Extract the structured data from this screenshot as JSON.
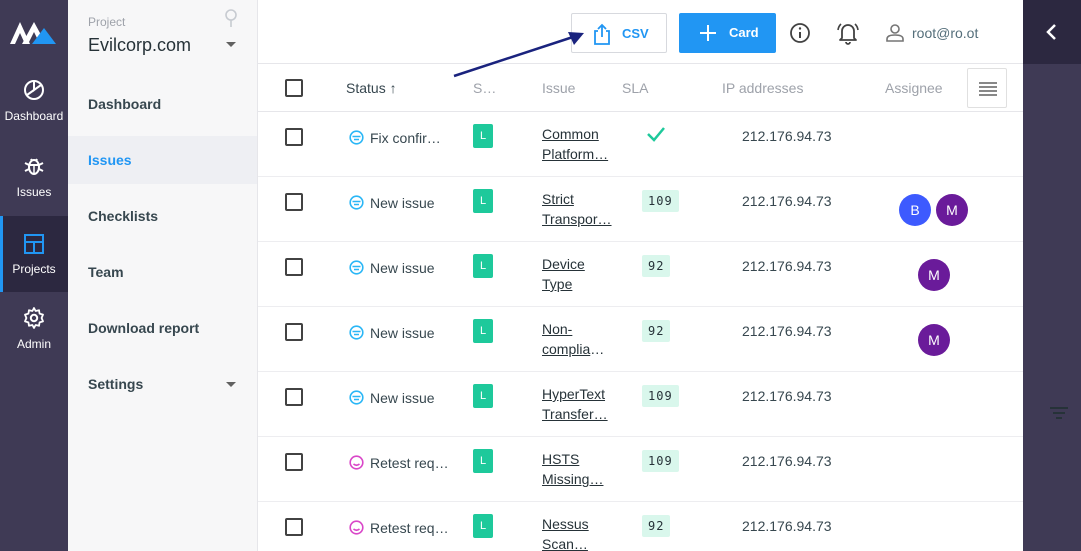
{
  "rail": {
    "items": [
      {
        "label": "Dashboard",
        "icon": "dashboard-icon"
      },
      {
        "label": "Issues",
        "icon": "bug-icon"
      },
      {
        "label": "Projects",
        "icon": "projects-icon"
      },
      {
        "label": "Admin",
        "icon": "gear-icon"
      }
    ],
    "active": "Projects",
    "colors": {
      "bg": "#3f3a55",
      "active_bg": "#2c2840",
      "accent": "#2196f3"
    }
  },
  "project": {
    "label": "Project",
    "name": "Evilcorp.com"
  },
  "sidebar": {
    "items": [
      {
        "label": "Dashboard"
      },
      {
        "label": "Issues"
      },
      {
        "label": "Checklists"
      },
      {
        "label": "Team"
      },
      {
        "label": "Download report"
      },
      {
        "label": "Settings"
      }
    ],
    "active": "Issues"
  },
  "toolbar": {
    "csv_label": "CSV",
    "card_label": "Card",
    "user": "root@ro.ot"
  },
  "table": {
    "columns": {
      "status": "Status ↑",
      "severity": "S…",
      "issue": "Issue",
      "sla": "SLA",
      "ip": "IP addresses",
      "assignee": "Assignee"
    },
    "rows": [
      {
        "status": "Fix confirmed",
        "status_icon": "fix-confirmed-icon",
        "severity": "L",
        "issue": [
          "Common",
          "Platform…"
        ],
        "sla": "",
        "sla_met": true,
        "ip": "212.176.94.73",
        "assignees": []
      },
      {
        "status": "New issue",
        "status_icon": "new-issue-icon",
        "severity": "L",
        "issue": [
          "Strict",
          "Transpor…"
        ],
        "sla": "109",
        "sla_met": false,
        "ip": "212.176.94.73",
        "assignees": [
          {
            "initial": "B",
            "color": "#3d5afe"
          },
          {
            "initial": "M",
            "color": "#6a1b9a"
          }
        ]
      },
      {
        "status": "New issue",
        "status_icon": "new-issue-icon",
        "severity": "L",
        "issue": [
          "Device",
          "Type"
        ],
        "sla": "92",
        "sla_met": false,
        "ip": "212.176.94.73",
        "assignees": [
          {
            "initial": "M",
            "color": "#6a1b9a"
          }
        ]
      },
      {
        "status": "New issue",
        "status_icon": "new-issue-icon",
        "severity": "L",
        "issue": [
          "Non-",
          "complian…"
        ],
        "sla": "92",
        "sla_met": false,
        "ip": "212.176.94.73",
        "assignees": [
          {
            "initial": "M",
            "color": "#6a1b9a"
          }
        ]
      },
      {
        "status": "New issue",
        "status_icon": "new-issue-icon",
        "severity": "L",
        "issue": [
          "HyperText",
          "Transfer…"
        ],
        "sla": "109",
        "sla_met": false,
        "ip": "212.176.94.73",
        "assignees": []
      },
      {
        "status": "Retest required",
        "status_icon": "retest-icon",
        "severity": "L",
        "issue": [
          "HSTS",
          "Missing…"
        ],
        "sla": "109",
        "sla_met": false,
        "ip": "212.176.94.73",
        "assignees": []
      },
      {
        "status": "Retest required",
        "status_icon": "retest-icon",
        "severity": "L",
        "issue": [
          "Nessus",
          "Scan…"
        ],
        "sla": "92",
        "sla_met": false,
        "ip": "212.176.94.73",
        "assignees": []
      }
    ]
  },
  "colors": {
    "primary": "#2196f3",
    "severity_low": "#1ec99b",
    "sla_bg": "#d9f7ec",
    "new_issue": "#29b6f6",
    "retest": "#d946c8",
    "annotation_arrow": "#1a237e"
  }
}
